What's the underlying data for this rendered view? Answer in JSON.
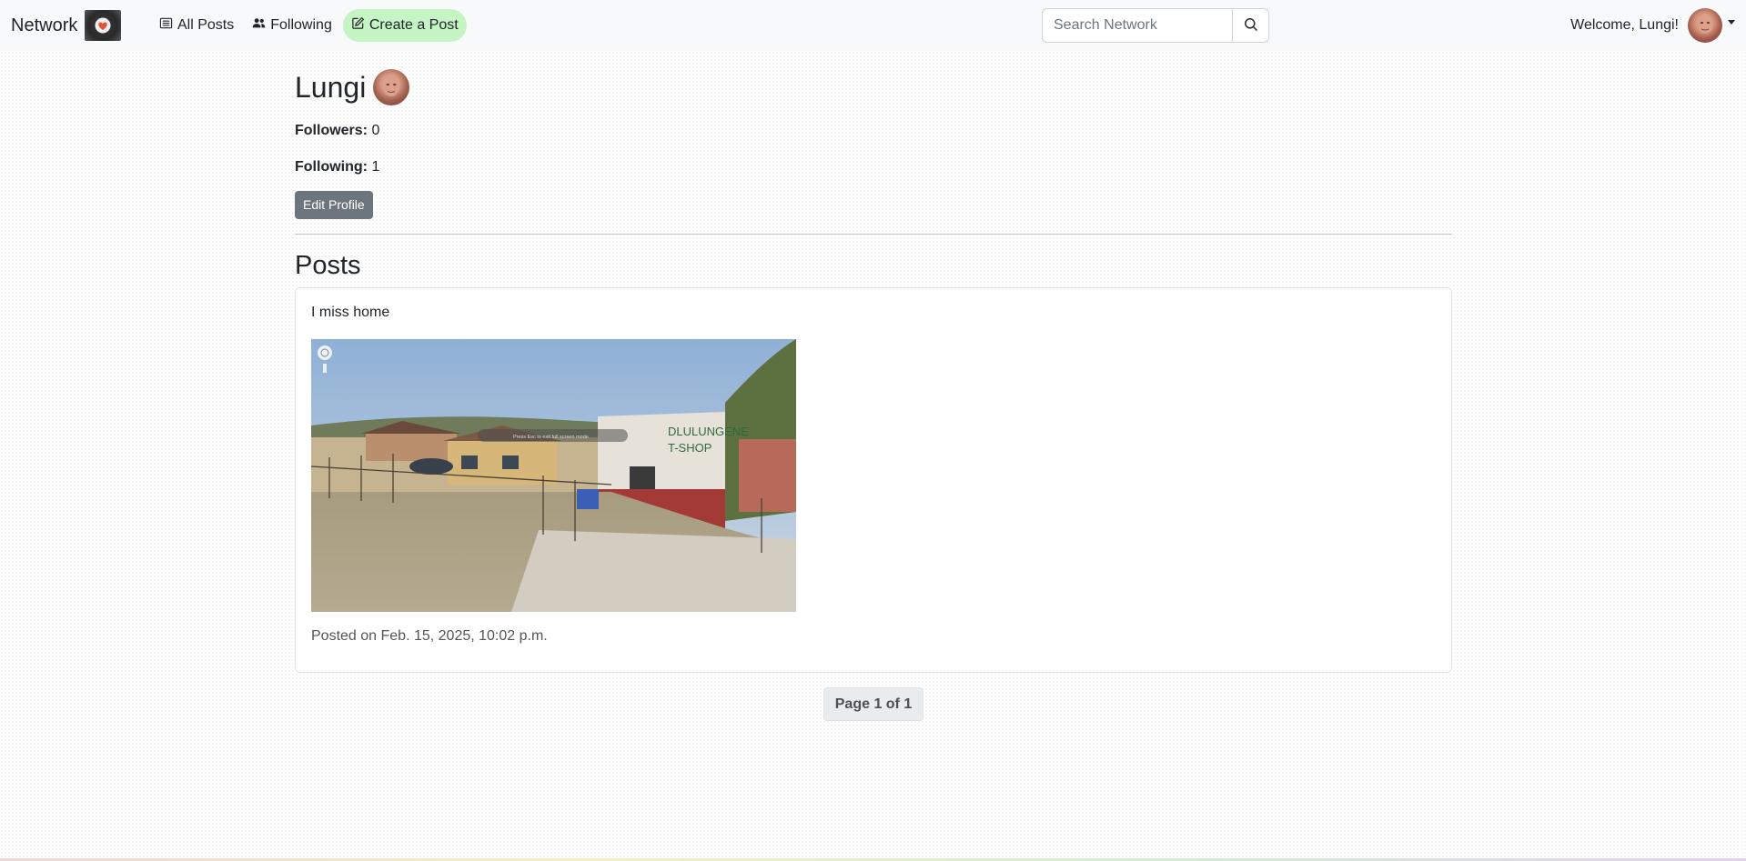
{
  "navbar": {
    "brand": "Network",
    "links": {
      "all_posts": "All Posts",
      "following": "Following",
      "create_post": "Create a Post"
    },
    "search_placeholder": "Search Network",
    "welcome": "Welcome, Lungi!"
  },
  "profile": {
    "name": "Lungi",
    "followers_label": "Followers:",
    "followers_count": "0",
    "following_label": "Following:",
    "following_count": "1",
    "edit_button": "Edit Profile"
  },
  "posts": {
    "heading": "Posts",
    "items": [
      {
        "text": "I miss home",
        "image_sign": [
          "DLULUNGENE",
          "T-SHOP"
        ],
        "image_overlay": "Press Esc to exit full screen mode",
        "date": "Posted on Feb. 15, 2025, 10:02 p.m."
      }
    ]
  },
  "pagination": {
    "label": "Page 1 of 1"
  },
  "colors": {
    "navbar_bg": "#f8f9fa",
    "create_post_bg": "#c5f5c5",
    "edit_button_bg": "#6c757d",
    "pager_bg": "#e9ecef"
  },
  "icons": {
    "brand": "heart-logo-icon",
    "all_posts": "list-icon",
    "following": "people-icon",
    "create_post": "pencil-square-icon",
    "search": "search-icon"
  }
}
